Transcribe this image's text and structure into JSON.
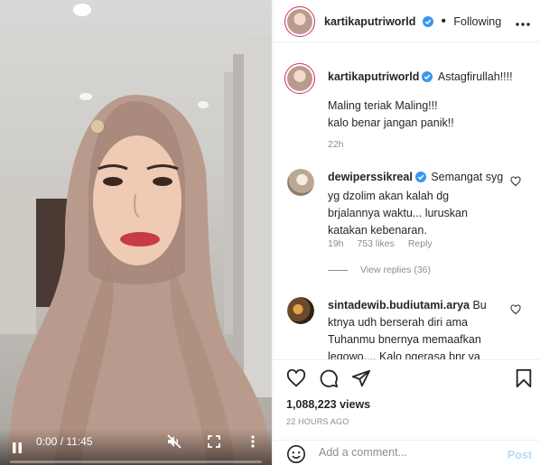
{
  "video": {
    "time_display": "0:00 / 11:45",
    "progress": 0.0,
    "icons": {
      "play": "pause-icon",
      "mute": "muted-speaker-icon",
      "fullscreen": "fullscreen-icon",
      "more": "more-vertical-icon"
    }
  },
  "header": {
    "username": "kartikaputriworld",
    "separator": "•",
    "follow_status": "Following",
    "more_icon": "more-horizontal-icon"
  },
  "caption": {
    "username": "kartikaputriworld",
    "first_line": "Astagfirullah!!!!",
    "lines": [
      "Maling teriak Maling!!!",
      "kalo benar jangan panik!!"
    ],
    "time": "22h"
  },
  "comments": [
    {
      "username": "dewiperssikreal",
      "verified": true,
      "text_lines": [
        "Semangat syg",
        "yg dzolim akan kalah dg",
        "brjalannya waktu... luruskan",
        "katakan kebenaran."
      ],
      "time": "19h",
      "likes": "753 likes",
      "reply": "Reply",
      "view_replies": "View replies (36)"
    },
    {
      "username": "sintadewib.budiutami.arya",
      "verified": false,
      "text_lines": [
        "Bu",
        "ktnya udh berserah diri ama",
        "Tuhanmu bnernya memaafkan",
        "legowo.... Kalo ngerasa bnr ya"
      ]
    }
  ],
  "actions": {
    "icons": [
      "heart-icon",
      "comment-icon",
      "share-icon",
      "bookmark-icon"
    ],
    "views": "1,088,223 views",
    "date": "22 HOURS AGO"
  },
  "add_comment": {
    "placeholder": "Add a comment...",
    "post_label": "Post"
  },
  "colors": {
    "verified": "#3897f0",
    "link_disabled": "#b3dbff",
    "muted": "#8e8e8e"
  }
}
